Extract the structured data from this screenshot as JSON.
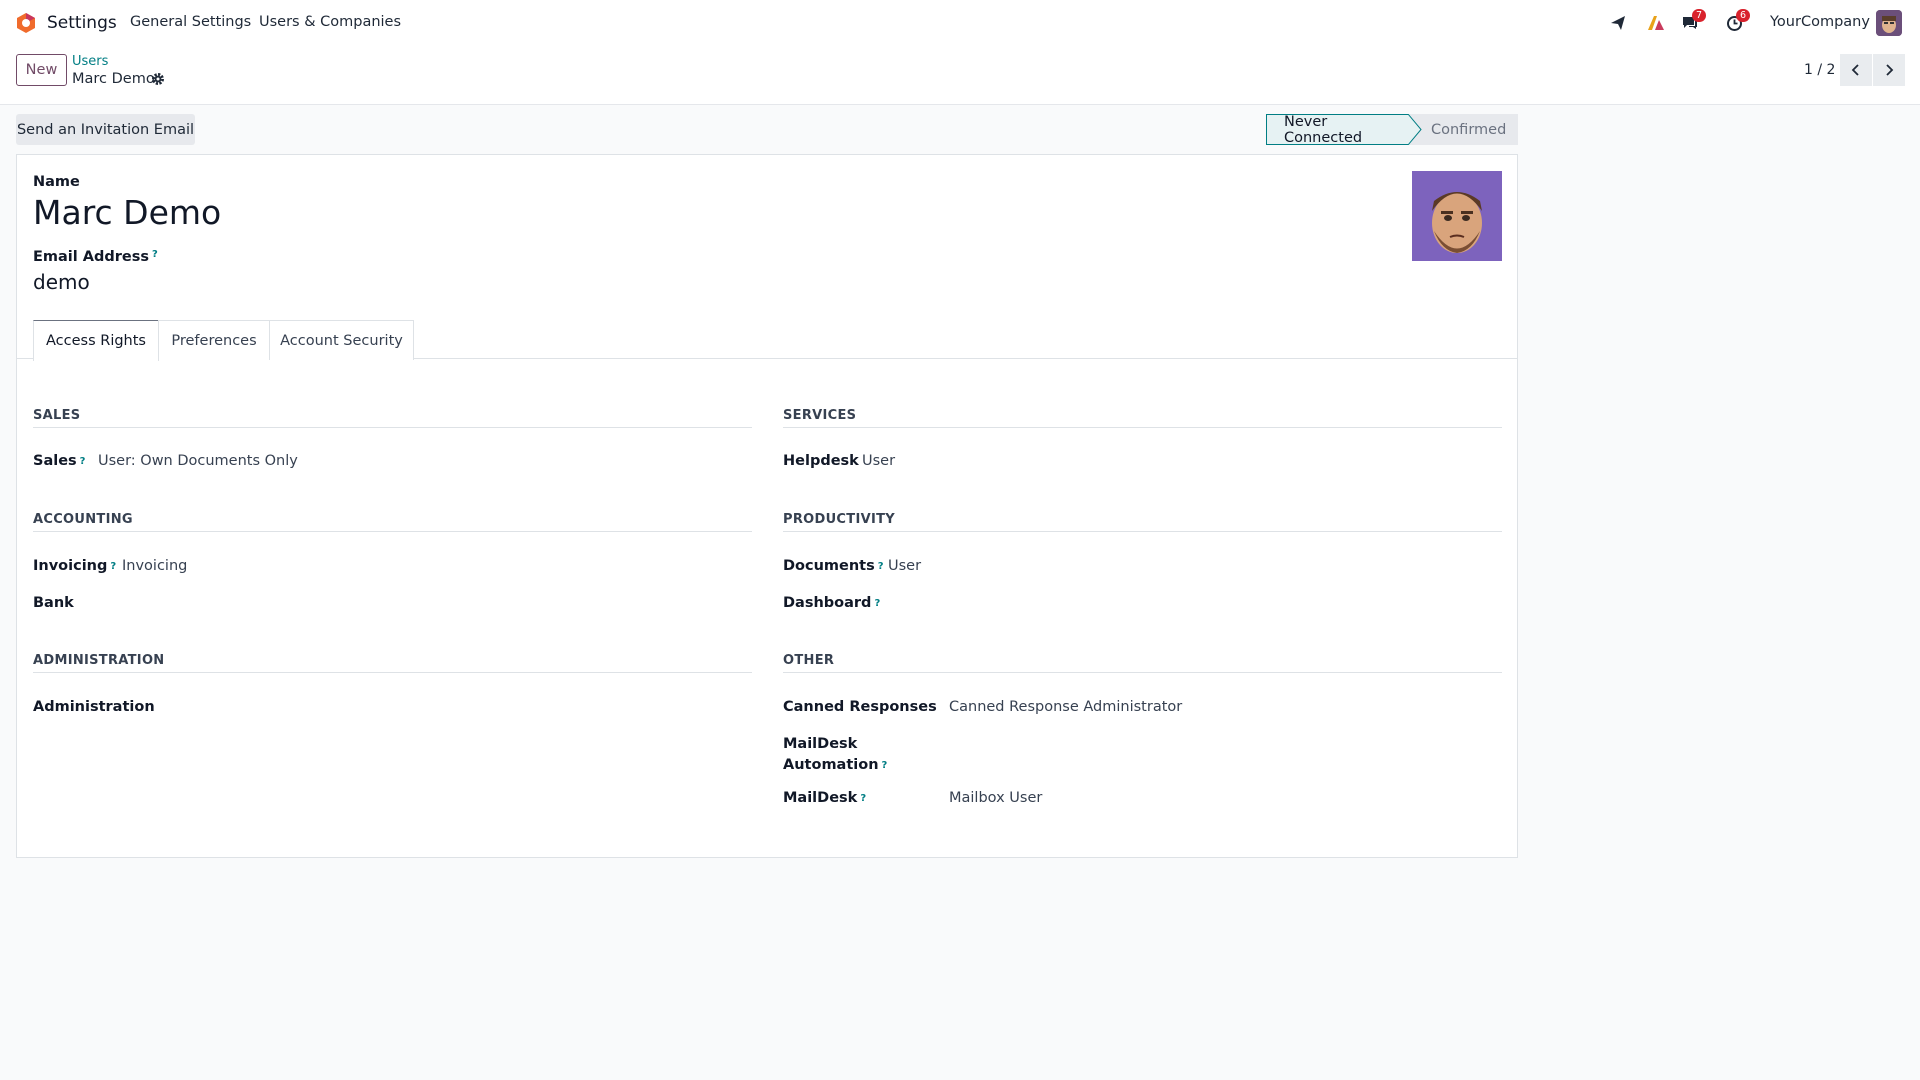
{
  "navbar": {
    "app_name": "Settings",
    "menu": [
      "General Settings",
      "Users & Companies"
    ],
    "chat_badge": "7",
    "activity_badge": "6",
    "company": "YourCompany"
  },
  "control_panel": {
    "new_label": "New",
    "breadcrumb_parent": "Users",
    "breadcrumb_current": "Marc Demo",
    "pager": "1 / 2"
  },
  "statusbar": {
    "invite_label": "Send an Invitation Email",
    "stages": [
      "Never Connected",
      "Confirmed"
    ],
    "active_stage": "Never Connected"
  },
  "form": {
    "name_label": "Name",
    "name_value": "Marc Demo",
    "email_label": "Email Address",
    "email_value": "demo",
    "help_mark": "?"
  },
  "tabs": [
    "Access Rights",
    "Preferences",
    "Account Security"
  ],
  "active_tab": "Access Rights",
  "access_rights": {
    "sales": {
      "title": "SALES",
      "fields": [
        {
          "label": "Sales",
          "value": "User: Own Documents Only",
          "help": true
        }
      ]
    },
    "services": {
      "title": "SERVICES",
      "fields": [
        {
          "label": "Helpdesk",
          "value": "User",
          "help": false
        }
      ]
    },
    "accounting": {
      "title": "ACCOUNTING",
      "fields": [
        {
          "label": "Invoicing",
          "value": "Invoicing",
          "help": true
        },
        {
          "label": "Bank",
          "value": "",
          "help": false
        }
      ]
    },
    "productivity": {
      "title": "PRODUCTIVITY",
      "fields": [
        {
          "label": "Documents",
          "value": "User",
          "help": true
        },
        {
          "label": "Dashboard",
          "value": "",
          "help": true
        }
      ]
    },
    "administration": {
      "title": "ADMINISTRATION",
      "fields": [
        {
          "label": "Administration",
          "value": "",
          "help": false
        }
      ]
    },
    "other": {
      "title": "OTHER",
      "fields": [
        {
          "label": "Canned Responses",
          "value": "Canned Response Administrator",
          "help": false
        },
        {
          "label_line1": "MailDesk",
          "label_line2": "Automation",
          "value": "",
          "help": true
        },
        {
          "label": "MailDesk",
          "value": "Mailbox User",
          "help": true
        }
      ]
    }
  },
  "colors": {
    "brand": "#714b67",
    "accent": "#017e84",
    "badge": "#d9232d"
  },
  "icons": [
    "app-logo-icon",
    "paper-plane-icon",
    "ai-icon",
    "chat-icon",
    "clock-icon",
    "gear-icon",
    "chevron-left-icon",
    "chevron-right-icon"
  ]
}
